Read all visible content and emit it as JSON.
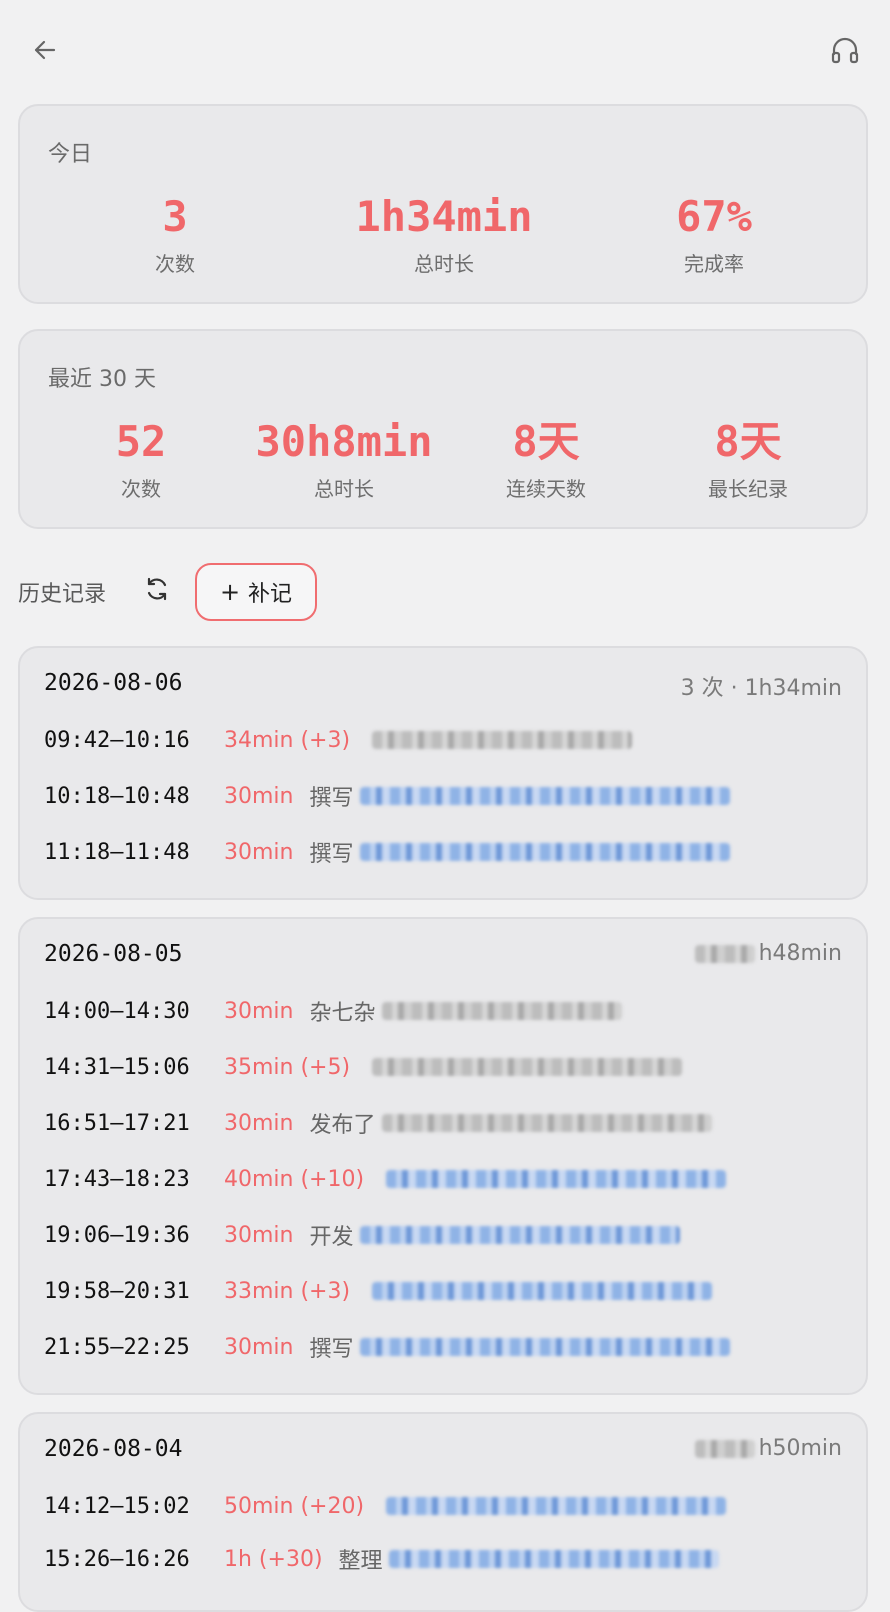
{
  "today": {
    "title": "今日",
    "stats": [
      {
        "value": "3",
        "label": "次数"
      },
      {
        "value": "1h34min",
        "label": "总时长"
      },
      {
        "value": "67%",
        "label": "完成率"
      }
    ]
  },
  "recent": {
    "title": "最近 30 天",
    "stats": [
      {
        "value": "52",
        "label": "次数"
      },
      {
        "value": "30h8min",
        "label": "总时长"
      },
      {
        "value": "8天",
        "label": "连续天数"
      },
      {
        "value": "8天",
        "label": "最长纪录"
      }
    ]
  },
  "history": {
    "label": "历史记录",
    "add_label": "补记"
  },
  "days": [
    {
      "date": "2026-08-06",
      "summary": "3 次 · 1h34min",
      "entries": [
        {
          "time": "09:42–10:16",
          "duration": "34min (+3)",
          "desc": "",
          "blur": "gray"
        },
        {
          "time": "10:18–10:48",
          "duration": "30min",
          "desc": "撰写",
          "blur": "blue"
        },
        {
          "time": "11:18–11:48",
          "duration": "30min",
          "desc": "撰写",
          "blur": "blue"
        }
      ]
    },
    {
      "date": "2026-08-05",
      "summary": "h48min",
      "entries": [
        {
          "time": "14:00–14:30",
          "duration": "30min",
          "desc": "杂七杂",
          "blur": "gray"
        },
        {
          "time": "14:31–15:06",
          "duration": "35min (+5)",
          "desc": "",
          "blur": "gray"
        },
        {
          "time": "16:51–17:21",
          "duration": "30min",
          "desc": "发布了",
          "blur": "gray"
        },
        {
          "time": "17:43–18:23",
          "duration": "40min (+10)",
          "desc": "",
          "blur": "blue"
        },
        {
          "time": "19:06–19:36",
          "duration": "30min",
          "desc": "开发",
          "blur": "blue"
        },
        {
          "time": "19:58–20:31",
          "duration": "33min (+3)",
          "desc": "",
          "blur": "blue"
        },
        {
          "time": "21:55–22:25",
          "duration": "30min",
          "desc": "撰写",
          "blur": "blue"
        }
      ]
    },
    {
      "date": "2026-08-04",
      "summary": "h50min",
      "entries": [
        {
          "time": "14:12–15:02",
          "duration": "50min (+20)",
          "desc": "",
          "blur": "blue"
        },
        {
          "time": "15:26–16:26",
          "duration": "1h (+30)",
          "desc": "整理",
          "blur": "blue"
        }
      ]
    }
  ],
  "icons": {
    "back": "arrow-left-icon",
    "headset": "headset-icon",
    "refresh": "refresh-icon",
    "plus": "plus-icon"
  },
  "colors": {
    "accent": "#f0676a",
    "card_bg": "#e9e9eb",
    "page_bg": "#f1f1f2"
  }
}
